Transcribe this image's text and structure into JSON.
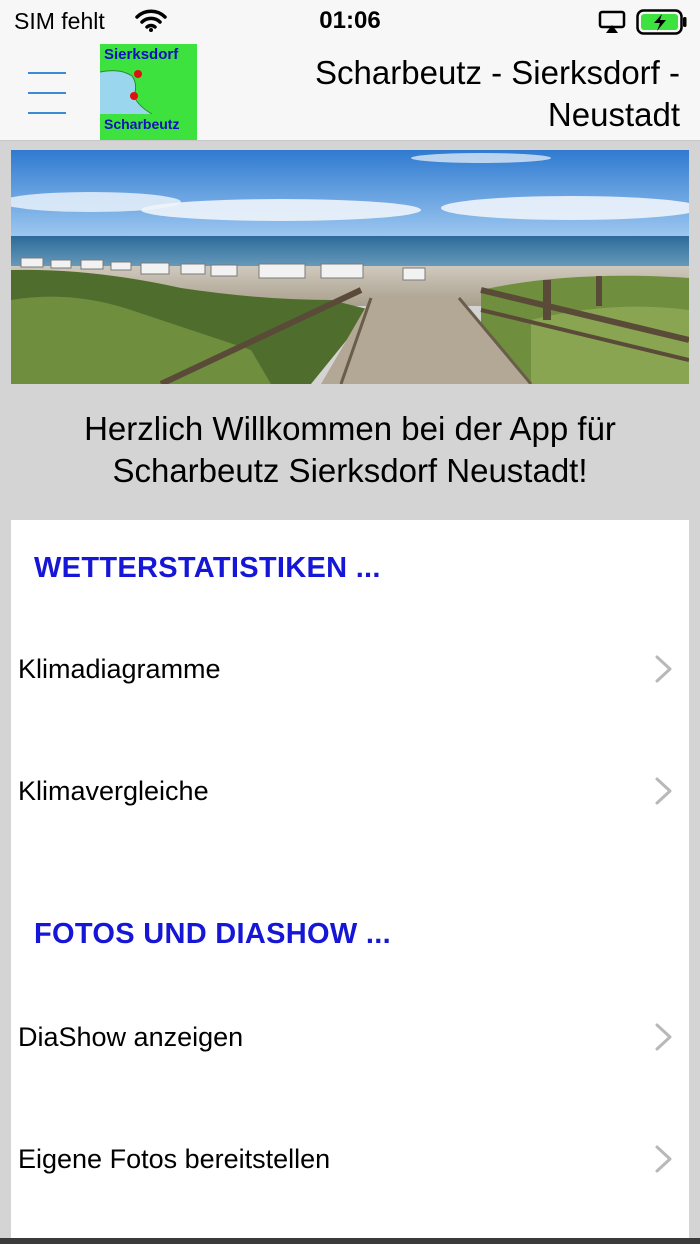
{
  "status_bar": {
    "carrier": "SIM fehlt",
    "time": "01:06"
  },
  "header": {
    "title": "Scharbeutz - Sierksdorf - Neustadt",
    "logo_top_text": "Sierksdorf",
    "logo_bottom_text": "Scharbeutz"
  },
  "welcome_text": "Herzlich Willkommen bei der App für Scharbeutz Sierksdorf Neustadt!",
  "sections": [
    {
      "title": "WETTERSTATISTIKEN ...",
      "items": [
        {
          "label": "Klimadiagramme"
        },
        {
          "label": "Klimavergleiche"
        }
      ]
    },
    {
      "title": "FOTOS UND DIASHOW ...",
      "items": [
        {
          "label": "DiaShow anzeigen"
        },
        {
          "label": "Eigene Fotos bereitstellen"
        }
      ]
    }
  ],
  "colors": {
    "section_header": "#1616d6",
    "menu_icon": "#3a8ad6",
    "logo_background": "#3ee23e",
    "battery_fill": "#3ee23e"
  }
}
